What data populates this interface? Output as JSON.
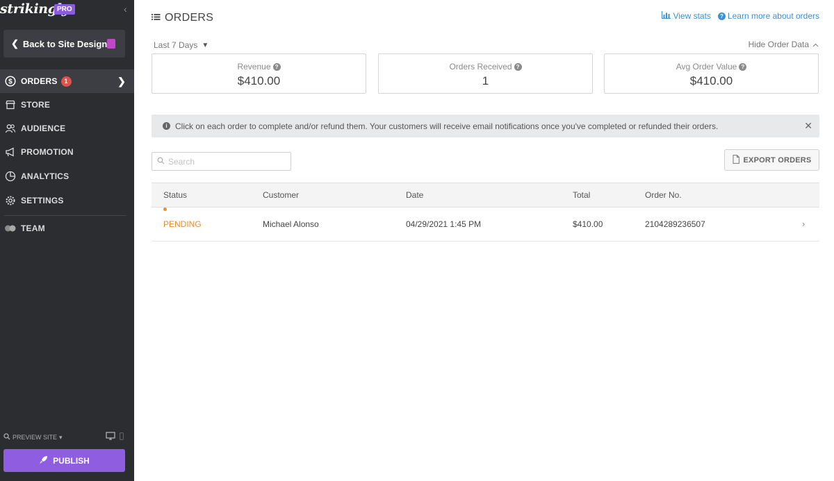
{
  "sidebar": {
    "logo": "strikingly",
    "pro_badge": "PRO",
    "back_label": "Back to Site Design",
    "nav": [
      {
        "label": "ORDERS",
        "badge": "1",
        "icon": "dollar-circle-icon"
      },
      {
        "label": "STORE",
        "icon": "store-icon"
      },
      {
        "label": "AUDIENCE",
        "icon": "audience-icon"
      },
      {
        "label": "PROMOTION",
        "icon": "megaphone-icon"
      },
      {
        "label": "ANALYTICS",
        "icon": "pie-chart-icon"
      },
      {
        "label": "SETTINGS",
        "icon": "gear-icon"
      },
      {
        "label": "TEAM",
        "icon": "team-icon"
      }
    ],
    "preview_label": "PREVIEW SITE",
    "publish_label": "PUBLISH"
  },
  "header": {
    "title": "ORDERS",
    "view_stats": "View stats",
    "learn_more": "Learn more about orders"
  },
  "filters": {
    "date_range": "Last 7 Days",
    "hide_data": "Hide Order Data"
  },
  "stats": [
    {
      "label": "Revenue",
      "value": "$410.00"
    },
    {
      "label": "Orders Received",
      "value": "1"
    },
    {
      "label": "Avg Order Value",
      "value": "$410.00"
    }
  ],
  "info": {
    "message": "Click on each order to complete and/or refund them. Your customers will receive email notifications once you've completed or refunded their orders."
  },
  "search": {
    "placeholder": "Search",
    "value": ""
  },
  "export_label": "EXPORT ORDERS",
  "table": {
    "columns": [
      "Status",
      "Customer",
      "Date",
      "Total",
      "Order No."
    ],
    "rows": [
      {
        "status": "PENDING",
        "customer": "Michael Alonso",
        "date": "04/29/2021 1:45 PM",
        "total": "$410.00",
        "order_no": "2104289236507"
      }
    ]
  },
  "colors": {
    "sidebar_bg": "#2c2d31",
    "accent_purple": "#8f5ee0",
    "link_blue": "#3a8fd9",
    "pending_orange": "#e88d2e",
    "badge_red": "#d9534f"
  }
}
